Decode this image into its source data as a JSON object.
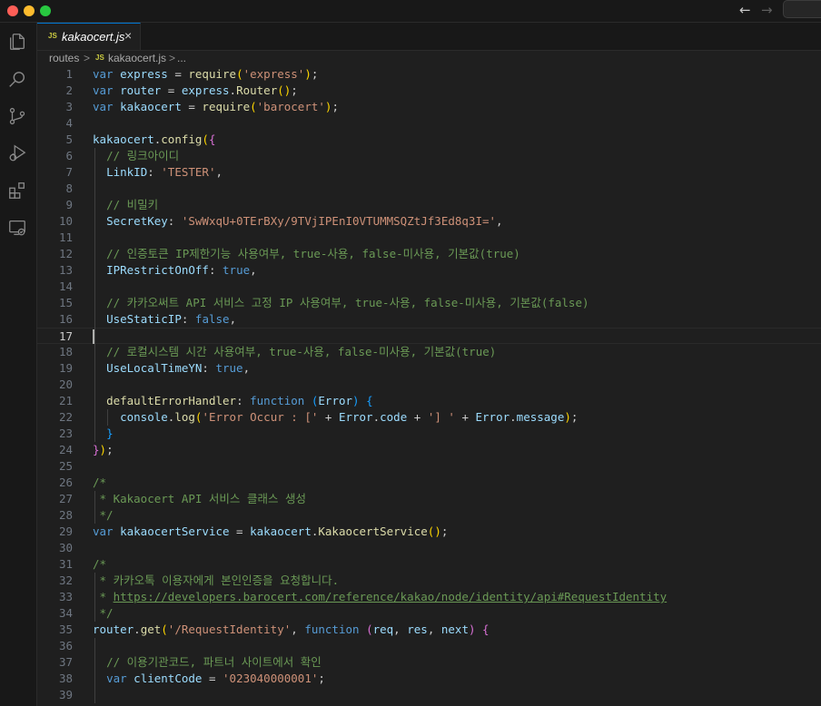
{
  "window": {
    "nav_back": "←",
    "nav_forward": "→"
  },
  "activity_bar": [
    {
      "name": "explorer-icon"
    },
    {
      "name": "search-icon"
    },
    {
      "name": "source-control-icon"
    },
    {
      "name": "run-debug-icon"
    },
    {
      "name": "extensions-icon"
    },
    {
      "name": "remote-explorer-icon"
    }
  ],
  "tab": {
    "badge": "JS",
    "label": "kakaocert.js",
    "close": "×"
  },
  "breadcrumb": {
    "folder": "routes",
    "sep1": ">",
    "badge": "JS",
    "file": "kakaocert.js",
    "sep2": ">",
    "more": "..."
  },
  "editor": {
    "current_line": 17,
    "lines": [
      {
        "n": "1",
        "tokens": [
          [
            "kw",
            "var "
          ],
          [
            "var",
            "express"
          ],
          [
            "p",
            " = "
          ],
          [
            "fn",
            "require"
          ],
          [
            "br1",
            "("
          ],
          [
            "str",
            "'express'"
          ],
          [
            "br1",
            ")"
          ],
          [
            "p",
            ";"
          ]
        ]
      },
      {
        "n": "2",
        "tokens": [
          [
            "kw",
            "var "
          ],
          [
            "var",
            "router"
          ],
          [
            "p",
            " = "
          ],
          [
            "var",
            "express"
          ],
          [
            "p",
            "."
          ],
          [
            "fn",
            "Router"
          ],
          [
            "br1",
            "()"
          ],
          [
            "p",
            ";"
          ]
        ]
      },
      {
        "n": "3",
        "tokens": [
          [
            "kw",
            "var "
          ],
          [
            "var",
            "kakaocert"
          ],
          [
            "p",
            " = "
          ],
          [
            "fn",
            "require"
          ],
          [
            "br1",
            "("
          ],
          [
            "str",
            "'barocert'"
          ],
          [
            "br1",
            ")"
          ],
          [
            "p",
            ";"
          ]
        ]
      },
      {
        "n": "4",
        "tokens": []
      },
      {
        "n": "5",
        "tokens": [
          [
            "var",
            "kakaocert"
          ],
          [
            "p",
            "."
          ],
          [
            "fn",
            "config"
          ],
          [
            "br1",
            "("
          ],
          [
            "br2",
            "{"
          ]
        ]
      },
      {
        "n": "6",
        "tokens": [
          [
            "p",
            "  "
          ],
          [
            "cm",
            "// 링크아이디"
          ]
        ]
      },
      {
        "n": "7",
        "tokens": [
          [
            "p",
            "  "
          ],
          [
            "prop",
            "LinkID"
          ],
          [
            "p",
            ": "
          ],
          [
            "str",
            "'TESTER'"
          ],
          [
            "p",
            ","
          ]
        ]
      },
      {
        "n": "8",
        "tokens": []
      },
      {
        "n": "9",
        "tokens": [
          [
            "p",
            "  "
          ],
          [
            "cm",
            "// 비밀키"
          ]
        ]
      },
      {
        "n": "10",
        "tokens": [
          [
            "p",
            "  "
          ],
          [
            "prop",
            "SecretKey"
          ],
          [
            "p",
            ": "
          ],
          [
            "str",
            "'SwWxqU+0TErBXy/9TVjIPEnI0VTUMMSQZtJf3Ed8q3I='"
          ],
          [
            "p",
            ","
          ]
        ]
      },
      {
        "n": "11",
        "tokens": []
      },
      {
        "n": "12",
        "tokens": [
          [
            "p",
            "  "
          ],
          [
            "cm",
            "// 인증토큰 IP제한기능 사용여부, true-사용, false-미사용, 기본값(true)"
          ]
        ]
      },
      {
        "n": "13",
        "tokens": [
          [
            "p",
            "  "
          ],
          [
            "prop",
            "IPRestrictOnOff"
          ],
          [
            "p",
            ": "
          ],
          [
            "kw",
            "true"
          ],
          [
            "p",
            ","
          ]
        ]
      },
      {
        "n": "14",
        "tokens": []
      },
      {
        "n": "15",
        "tokens": [
          [
            "p",
            "  "
          ],
          [
            "cm",
            "// 카카오써트 API 서비스 고정 IP 사용여부, true-사용, false-미사용, 기본값(false)"
          ]
        ]
      },
      {
        "n": "16",
        "tokens": [
          [
            "p",
            "  "
          ],
          [
            "prop",
            "UseStaticIP"
          ],
          [
            "p",
            ": "
          ],
          [
            "kw",
            "false"
          ],
          [
            "p",
            ","
          ]
        ]
      },
      {
        "n": "17",
        "tokens": []
      },
      {
        "n": "18",
        "tokens": [
          [
            "p",
            "  "
          ],
          [
            "cm",
            "// 로컬시스템 시간 사용여부, true-사용, false-미사용, 기본값(true)"
          ]
        ]
      },
      {
        "n": "19",
        "tokens": [
          [
            "p",
            "  "
          ],
          [
            "prop",
            "UseLocalTimeYN"
          ],
          [
            "p",
            ": "
          ],
          [
            "kw",
            "true"
          ],
          [
            "p",
            ","
          ]
        ]
      },
      {
        "n": "20",
        "tokens": []
      },
      {
        "n": "21",
        "tokens": [
          [
            "p",
            "  "
          ],
          [
            "fn",
            "defaultErrorHandler"
          ],
          [
            "p",
            ": "
          ],
          [
            "kw",
            "function "
          ],
          [
            "br3",
            "("
          ],
          [
            "var",
            "Error"
          ],
          [
            "br3",
            ")"
          ],
          [
            "p",
            " "
          ],
          [
            "br3",
            "{"
          ]
        ]
      },
      {
        "n": "22",
        "tokens": [
          [
            "p",
            "    "
          ],
          [
            "var",
            "console"
          ],
          [
            "p",
            "."
          ],
          [
            "fn",
            "log"
          ],
          [
            "br1",
            "("
          ],
          [
            "str",
            "'Error Occur : ['"
          ],
          [
            "p",
            " + "
          ],
          [
            "var",
            "Error"
          ],
          [
            "p",
            "."
          ],
          [
            "var",
            "code"
          ],
          [
            "p",
            " + "
          ],
          [
            "str",
            "'] '"
          ],
          [
            "p",
            " + "
          ],
          [
            "var",
            "Error"
          ],
          [
            "p",
            "."
          ],
          [
            "var",
            "message"
          ],
          [
            "br1",
            ")"
          ],
          [
            "p",
            ";"
          ]
        ]
      },
      {
        "n": "23",
        "tokens": [
          [
            "p",
            "  "
          ],
          [
            "br3",
            "}"
          ]
        ]
      },
      {
        "n": "24",
        "tokens": [
          [
            "br2",
            "}"
          ],
          [
            "br1",
            ")"
          ],
          [
            "p",
            ";"
          ]
        ]
      },
      {
        "n": "25",
        "tokens": []
      },
      {
        "n": "26",
        "tokens": [
          [
            "cm",
            "/*"
          ]
        ]
      },
      {
        "n": "27",
        "tokens": [
          [
            "cm",
            " * Kakaocert API 서비스 클래스 생성"
          ]
        ]
      },
      {
        "n": "28",
        "tokens": [
          [
            "cm",
            " */"
          ]
        ]
      },
      {
        "n": "29",
        "tokens": [
          [
            "kw",
            "var "
          ],
          [
            "var",
            "kakaocertService"
          ],
          [
            "p",
            " = "
          ],
          [
            "var",
            "kakaocert"
          ],
          [
            "p",
            "."
          ],
          [
            "fn",
            "KakaocertService"
          ],
          [
            "br1",
            "()"
          ],
          [
            "p",
            ";"
          ]
        ]
      },
      {
        "n": "30",
        "tokens": []
      },
      {
        "n": "31",
        "tokens": [
          [
            "cm",
            "/*"
          ]
        ]
      },
      {
        "n": "32",
        "tokens": [
          [
            "cm",
            " * 카카오톡 이용자에게 본인인증을 요청합니다."
          ]
        ]
      },
      {
        "n": "33",
        "tokens": [
          [
            "cm",
            " * "
          ],
          [
            "link",
            "https://developers.barocert.com/reference/kakao/node/identity/api#RequestIdentity"
          ]
        ]
      },
      {
        "n": "34",
        "tokens": [
          [
            "cm",
            " */"
          ]
        ]
      },
      {
        "n": "35",
        "tokens": [
          [
            "var",
            "router"
          ],
          [
            "p",
            "."
          ],
          [
            "fn",
            "get"
          ],
          [
            "br1",
            "("
          ],
          [
            "str",
            "'/RequestIdentity'"
          ],
          [
            "p",
            ", "
          ],
          [
            "kw",
            "function "
          ],
          [
            "br2",
            "("
          ],
          [
            "var",
            "req"
          ],
          [
            "p",
            ", "
          ],
          [
            "var",
            "res"
          ],
          [
            "p",
            ", "
          ],
          [
            "var",
            "next"
          ],
          [
            "br2",
            ")"
          ],
          [
            "p",
            " "
          ],
          [
            "br2",
            "{"
          ]
        ]
      },
      {
        "n": "36",
        "tokens": []
      },
      {
        "n": "37",
        "tokens": [
          [
            "p",
            "  "
          ],
          [
            "cm",
            "// 이용기관코드, 파트너 사이트에서 확인"
          ]
        ]
      },
      {
        "n": "38",
        "tokens": [
          [
            "p",
            "  "
          ],
          [
            "kw",
            "var "
          ],
          [
            "var",
            "clientCode"
          ],
          [
            "p",
            " = "
          ],
          [
            "str",
            "'023040000001'"
          ],
          [
            "p",
            ";"
          ]
        ]
      },
      {
        "n": "39",
        "tokens": []
      }
    ]
  }
}
